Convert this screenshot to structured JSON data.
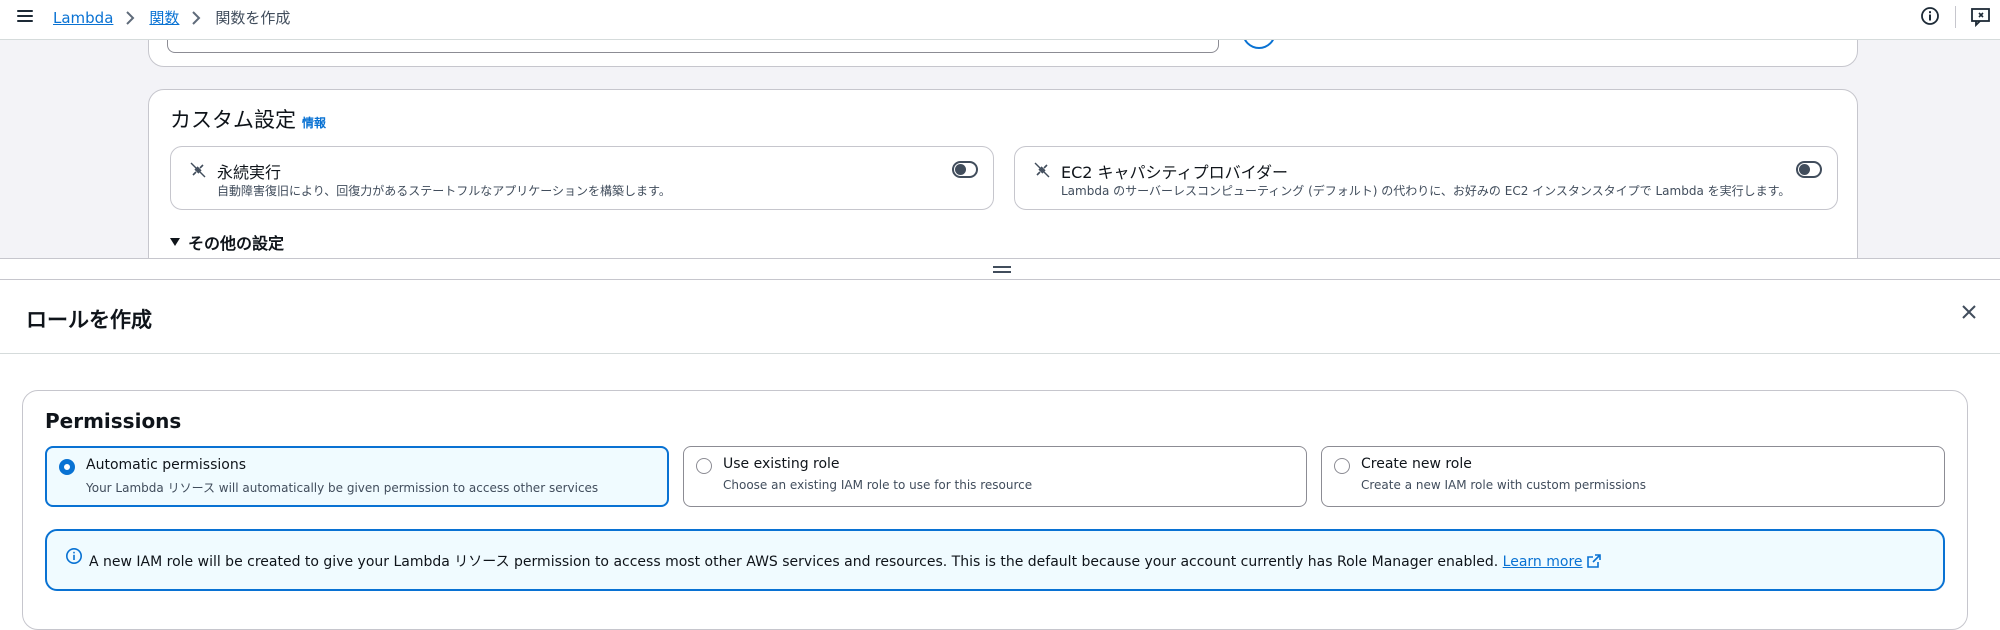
{
  "breadcrumb": {
    "items": [
      "Lambda",
      "関数"
    ],
    "current": "関数を作成"
  },
  "custom_settings": {
    "title": "カスタム設定",
    "info_link": "情報",
    "durable": {
      "title": "永続実行",
      "description": "自動障害復旧により、回復力があるステートフルなアプリケーションを構築します。",
      "enabled": false
    },
    "ec2": {
      "title": "EC2 キャパシティプロバイダー",
      "description": "Lambda のサーバーレスコンピューティング (デフォルト) の代わりに、お好みの EC2 インスタンスタイプで Lambda を実行します。",
      "enabled": false
    },
    "other_settings": "その他の設定"
  },
  "panel": {
    "title": "ロールを作成"
  },
  "permissions": {
    "title": "Permissions",
    "options": [
      {
        "label": "Automatic permissions",
        "description": "Your Lambda リソース will automatically be given permission to access other services",
        "selected": true
      },
      {
        "label": "Use existing role",
        "description": "Choose an existing IAM role to use for this resource",
        "selected": false
      },
      {
        "label": "Create new role",
        "description": "Create a new IAM role with custom permissions",
        "selected": false
      }
    ],
    "alert_text": "A new IAM role will be created to give your Lambda リソース permission to access most other AWS services and resources. This is the default because your account currently has Role Manager enabled.",
    "alert_link": "Learn more"
  },
  "colors": {
    "accent": "#0972d3",
    "selected_bg": "#f0fbff",
    "page_bg": "#f3f3f7"
  }
}
